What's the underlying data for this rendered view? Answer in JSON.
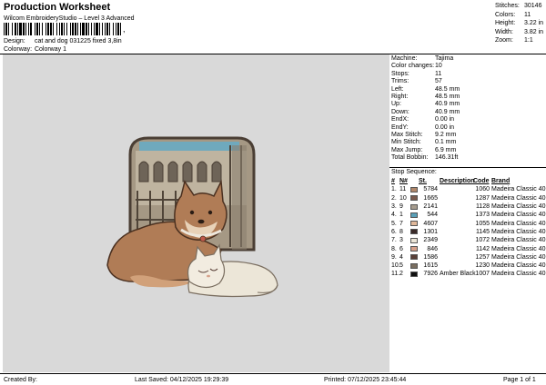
{
  "header": {
    "title": "Production Worksheet",
    "subtitle": "Wilcom EmbroideryStudio – Level 3 Advanced",
    "barcode_suffix": ",",
    "design_label": "Design:",
    "design_value": "cat and dog 031225 fixed 3,8in",
    "colorway_label": "Colorway:",
    "colorway_value": "Colorway 1"
  },
  "stats": [
    {
      "k": "Stitches:",
      "v": "30146"
    },
    {
      "k": "Colors:",
      "v": "11"
    },
    {
      "k": "Height:",
      "v": "3.22 in"
    },
    {
      "k": "Width:",
      "v": "3.82 in"
    },
    {
      "k": "Zoom:",
      "v": "1:1"
    }
  ],
  "machine_info": [
    {
      "k": "Machine:",
      "v": "Tajima"
    },
    {
      "k": "Color changes:",
      "v": "10"
    },
    {
      "k": "Stops:",
      "v": "11"
    },
    {
      "k": "Trims:",
      "v": "57"
    },
    {
      "k": "Left:",
      "v": "48.5 mm"
    },
    {
      "k": "Right:",
      "v": "48.5 mm"
    },
    {
      "k": "Up:",
      "v": "40.9 mm"
    },
    {
      "k": "Down:",
      "v": "40.9 mm"
    },
    {
      "k": "EndX:",
      "v": "0.00 in"
    },
    {
      "k": "EndY:",
      "v": "0.00 in"
    },
    {
      "k": "Max Stitch:",
      "v": "9.2 mm"
    },
    {
      "k": "Min Stitch:",
      "v": "0.1 mm"
    },
    {
      "k": "Max Jump:",
      "v": "6.9 mm"
    },
    {
      "k": "Total Bobbin:",
      "v": "146.31ft"
    }
  ],
  "stop_sequence": {
    "title": "Stop Sequence:",
    "headers": {
      "num": "#",
      "n": "N#",
      "st": "St.",
      "desc": "Description",
      "code": "Code",
      "brand": "Brand"
    },
    "rows": [
      {
        "num": "1.",
        "n": "11",
        "color": "#b0876a",
        "st": "5784",
        "desc": "",
        "code": "1060",
        "brand": "Madeira Classic 40"
      },
      {
        "num": "2.",
        "n": "10",
        "color": "#7a5a4e",
        "st": "1665",
        "desc": "",
        "code": "1287",
        "brand": "Madeira Classic 40"
      },
      {
        "num": "3.",
        "n": "9",
        "color": "#a79d8f",
        "st": "2141",
        "desc": "",
        "code": "1128",
        "brand": "Madeira Classic 40"
      },
      {
        "num": "4.",
        "n": "1",
        "color": "#5aa0b8",
        "st": "544",
        "desc": "",
        "code": "1373",
        "brand": "Madeira Classic 40"
      },
      {
        "num": "5.",
        "n": "7",
        "color": "#e0b89a",
        "st": "4607",
        "desc": "",
        "code": "1055",
        "brand": "Madeira Classic 40"
      },
      {
        "num": "6.",
        "n": "8",
        "color": "#3a2a28",
        "st": "1301",
        "desc": "",
        "code": "1145",
        "brand": "Madeira Classic 40"
      },
      {
        "num": "7.",
        "n": "3",
        "color": "#ece6d8",
        "st": "2349",
        "desc": "",
        "code": "1072",
        "brand": "Madeira Classic 40"
      },
      {
        "num": "8.",
        "n": "6",
        "color": "#d6a08a",
        "st": "846",
        "desc": "",
        "code": "1142",
        "brand": "Madeira Classic 40"
      },
      {
        "num": "9.",
        "n": "4",
        "color": "#5a4038",
        "st": "1586",
        "desc": "",
        "code": "1257",
        "brand": "Madeira Classic 40"
      },
      {
        "num": "10.",
        "n": "5",
        "color": "#7a6e60",
        "st": "1615",
        "desc": "",
        "code": "1230",
        "brand": "Madeira Classic 40"
      },
      {
        "num": "11.",
        "n": "2",
        "color": "#111111",
        "st": "7926",
        "desc": "Amber Black",
        "code": "1007",
        "brand": "Madeira Classic 40"
      }
    ]
  },
  "footer": {
    "created_by": "Created By:",
    "last_saved": "Last Saved: 04/12/2025 19:29:39",
    "printed": "Printed: 07/12/2025 23:45:44",
    "page": "Page 1 of 1"
  },
  "icons": {
    "design_preview": "embroidery-design-image"
  }
}
